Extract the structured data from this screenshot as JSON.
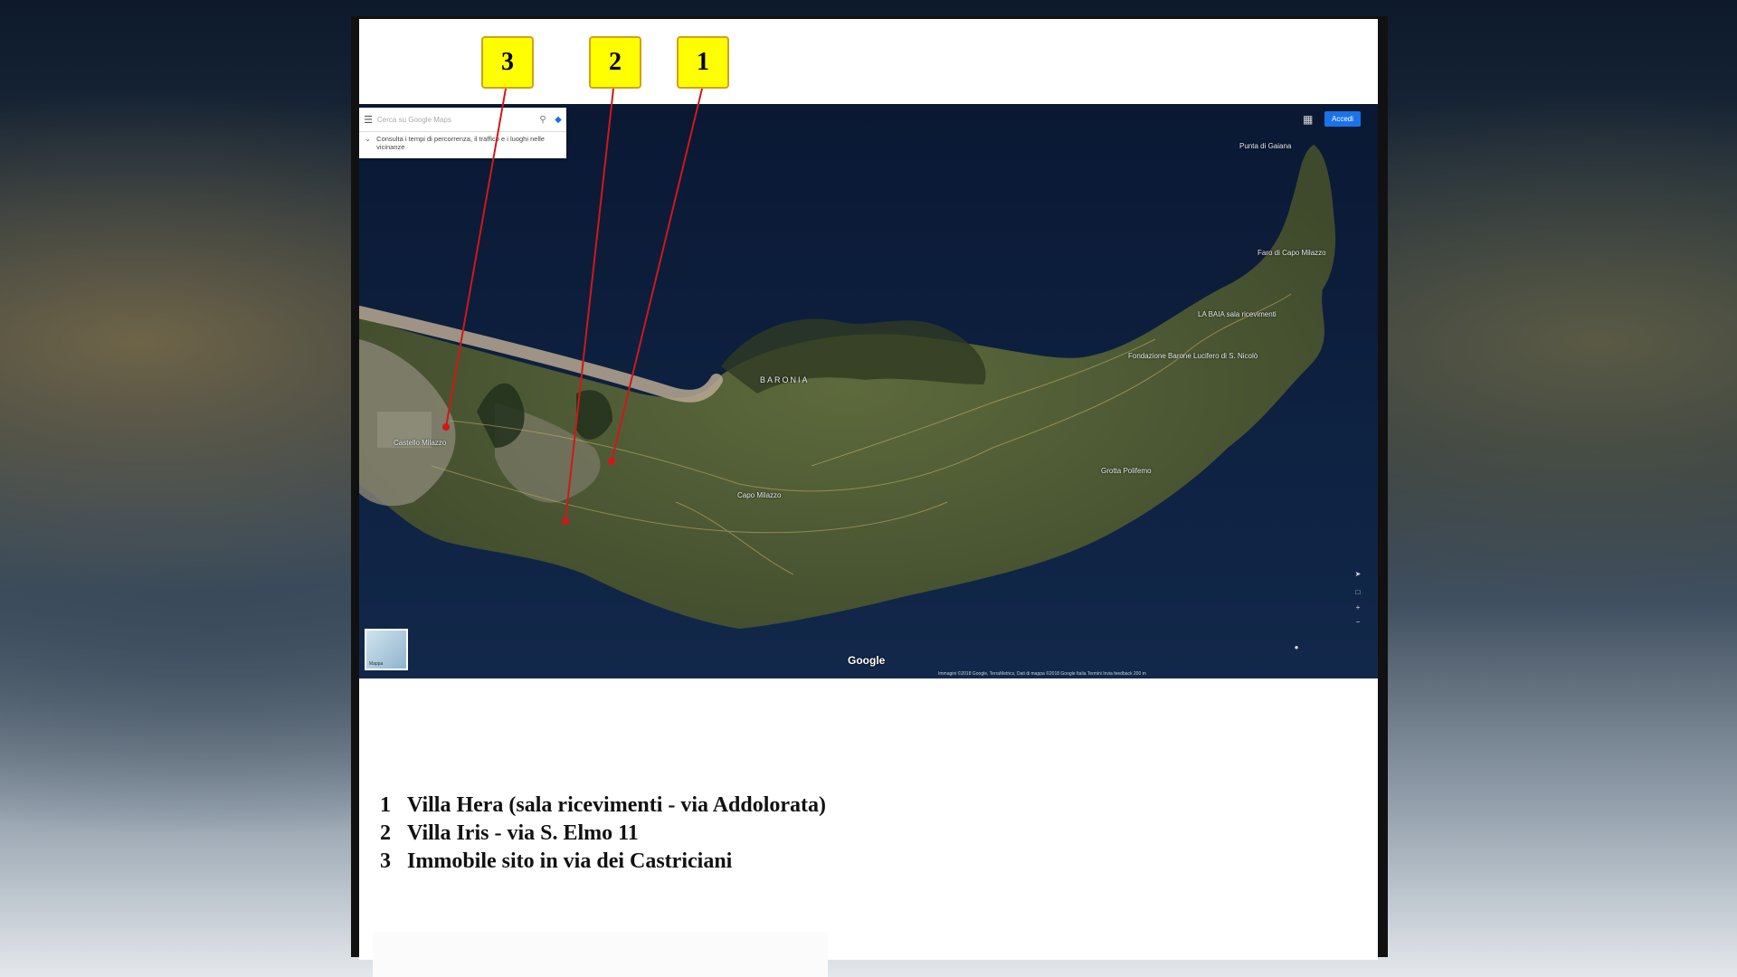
{
  "search": {
    "placeholder": "Cerca su Google Maps",
    "menu_icon": "menu-icon",
    "search_icon": "search-icon",
    "directions_icon": "directions-icon",
    "hint": "Consulta i tempi di percorrenza, il traffico e i luoghi nelle vicinanze"
  },
  "topbar": {
    "apps_icon": "apps-grid-icon",
    "signin_label": "Accedi"
  },
  "map": {
    "area_label": "BARONIA",
    "logo": "Google",
    "thumbnail_label": "Mappa",
    "attribution": "Immagini ©2018 Google, TerraMetrics, Dati di mappa ©2018 Google   Italia   Termini   Invia feedback   200 m",
    "places": [
      {
        "name": "Punta di Gaiana"
      },
      {
        "name": "Faro di Capo Milazzo"
      },
      {
        "name": "LA BAIA sala ricevimenti"
      },
      {
        "name": "Fondazione Barone Lucifero di S. Nicolò"
      },
      {
        "name": "Castello Milazzo"
      },
      {
        "name": "Capo Milazzo"
      },
      {
        "name": "Grotta Polifemo"
      }
    ]
  },
  "callouts": [
    {
      "number": "3"
    },
    {
      "number": "2"
    },
    {
      "number": "1"
    }
  ],
  "legend": [
    {
      "num": "1",
      "text": "Villa Hera (sala ricevimenti - via Addolorata)"
    },
    {
      "num": "2",
      "text": "Villa Iris - via S. Elmo 11"
    },
    {
      "num": "3",
      "text": "Immobile sito in via dei Castriciani"
    }
  ],
  "colors": {
    "callout": "#ffff00",
    "pointer": "#d01818",
    "sea": "#0c1c38"
  }
}
